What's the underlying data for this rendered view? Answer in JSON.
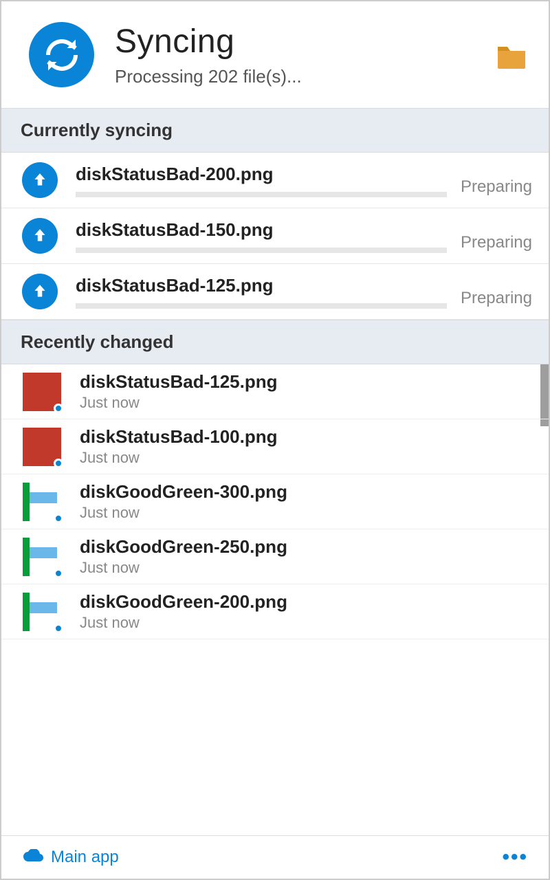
{
  "header": {
    "title": "Syncing",
    "subtitle": "Processing 202 file(s)..."
  },
  "sections": {
    "syncing_label": "Currently syncing",
    "recent_label": "Recently changed"
  },
  "syncing": [
    {
      "name": "diskStatusBad-200.png",
      "status": "Preparing"
    },
    {
      "name": "diskStatusBad-150.png",
      "status": "Preparing"
    },
    {
      "name": "diskStatusBad-125.png",
      "status": "Preparing"
    }
  ],
  "recent": [
    {
      "name": "diskStatusBad-125.png",
      "time": "Just now",
      "thumb": "red"
    },
    {
      "name": "diskStatusBad-100.png",
      "time": "Just now",
      "thumb": "red"
    },
    {
      "name": "diskGoodGreen-300.png",
      "time": "Just now",
      "thumb": "green"
    },
    {
      "name": "diskGoodGreen-250.png",
      "time": "Just now",
      "thumb": "green"
    },
    {
      "name": "diskGoodGreen-200.png",
      "time": "Just now",
      "thumb": "green"
    }
  ],
  "footer": {
    "app_label": "Main app"
  },
  "colors": {
    "accent": "#0a84d6",
    "folder": "#e8a33d",
    "red": "#c1392b",
    "green": "#0a9b3b"
  }
}
